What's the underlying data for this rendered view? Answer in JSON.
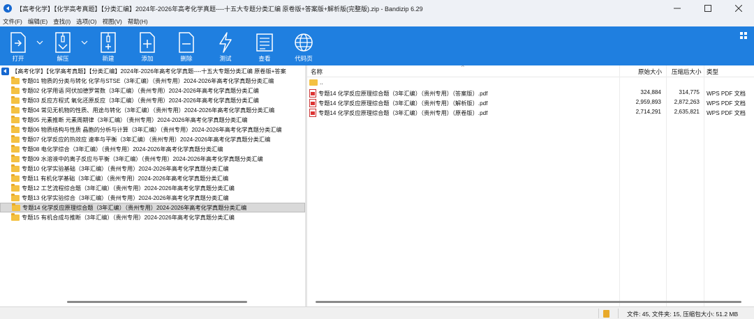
{
  "window": {
    "title": "【高考化学】【化学高考真题】【分类汇编】2024年-2026年高考化学真题----十五大专题分类汇编 原卷版+答案版+解析版(完整版).zip - Bandizip 6.29"
  },
  "menu": [
    "文件(F)",
    "编辑(E)",
    "查找(I)",
    "选项(O)",
    "视图(V)",
    "帮助(H)"
  ],
  "toolbar": {
    "open": "打开",
    "extract": "解压",
    "new": "新建",
    "add": "添加",
    "delete": "删除",
    "test": "测试",
    "view": "查看",
    "codepage": "代码页"
  },
  "tree": {
    "root": "【高考化学】【化学高考真题】【分类汇编】2024年-2026年高考化学真题----十五大专题分类汇编 原卷版+答案",
    "items": [
      "专题01 物质的分类与转化 化学与STSE（3年汇编）（贵州专用）2024-2026年高考化学真题分类汇编",
      "专题02 化学用语 阿伏加德罗常数（3年汇编）（贵州专用）2024-2026年高考化学真题分类汇编",
      "专题03 反应方程式 氧化还原反应（3年汇编）（贵州专用）2024-2026年高考化学真题分类汇编",
      "专题04 常见无机物的性质、用途与转化（3年汇编）（贵州专用）2024-2026年高考化学真题分类汇编",
      "专题05 元素推断 元素周期律（3年汇编）（贵州专用）2024-2026年高考化学真题分类汇编",
      "专题06 物质结构与性质 晶胞的分析与计算（3年汇编）（贵州专用）2024-2026年高考化学真题分类汇编",
      "专题07 化学反应的热效应 速率与平衡（3年汇编）（贵州专用）2024-2026年高考化学真题分类汇编",
      "专题08 电化学综合（3年汇编）（贵州专用）2024-2026年高考化学真题分类汇编",
      "专题09 水溶液中的离子反应与平衡（3年汇编）（贵州专用）2024-2026年高考化学真题分类汇编",
      "专题10 化学实验基础（3年汇编）（贵州专用）2024-2026年高考化学真题分类汇编",
      "专题11 有机化学基础（3年汇编）（贵州专用）2024-2026年高考化学真题分类汇编",
      "专题12 工艺流程综合题（3年汇编）（贵州专用）2024-2026年高考化学真题分类汇编",
      "专题13 化学实验综合（3年汇编）（贵州专用）2024-2026年高考化学真题分类汇编",
      "专题14 化学反应原理综合题（3年汇编）（贵州专用）2024-2026年高考化学真题分类汇编",
      "专题15 有机合成与推断（3年汇编）（贵州专用）2024-2026年高考化学真题分类汇编"
    ],
    "selected_index": 13
  },
  "list": {
    "headers": {
      "name": "名称",
      "original_size": "原始大小",
      "compressed_size": "压缩后大小",
      "type": "类型"
    },
    "parent": "..",
    "files": [
      {
        "name": "专题14 化学反应原理综合题（3年汇编）（贵州专用）（答案版）.pdf",
        "original_size": "324,884",
        "compressed_size": "314,775",
        "type": "WPS PDF 文档"
      },
      {
        "name": "专题14 化学反应原理综合题（3年汇编）（贵州专用）（解析版）.pdf",
        "original_size": "2,959,893",
        "compressed_size": "2,872,263",
        "type": "WPS PDF 文档"
      },
      {
        "name": "专题14 化学反应原理综合题（3年汇编）（贵州专用）（原卷版）.pdf",
        "original_size": "2,714,291",
        "compressed_size": "2,635,821",
        "type": "WPS PDF 文档"
      }
    ]
  },
  "status": {
    "text": "文件: 45, 文件夹: 15, 压缩包大小: 51.2 MB"
  },
  "colors": {
    "toolbar_bg": "#1f7fe0",
    "titlebar_bg": "#eef1f6",
    "selection_bg": "#d9d9d9",
    "folder": "#f4c142"
  },
  "icons": [
    "app-icon",
    "open-icon",
    "extract-icon",
    "new-icon",
    "add-icon",
    "delete-icon",
    "test-icon",
    "view-icon",
    "codepage-icon",
    "folder-icon",
    "pdf-icon",
    "layout-grid-icon"
  ]
}
